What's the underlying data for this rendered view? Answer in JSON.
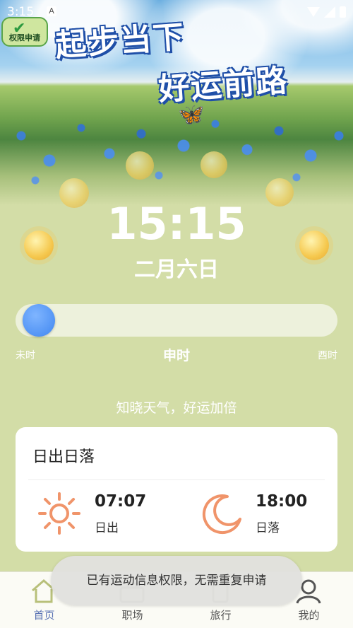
{
  "status_bar": {
    "time": "3:15",
    "notification_letter": "A"
  },
  "hero": {
    "badge_label": "权限申请",
    "title_line1": "起步当下",
    "title_line2": "好运前路"
  },
  "clock": {
    "time": "15:15",
    "date": "二月六日"
  },
  "hour_slider": {
    "prev_label": "未时",
    "current_label": "申时",
    "next_label": "酉时",
    "value": 0.0
  },
  "slogan": "知晓天气，好运加倍",
  "sun_card": {
    "title": "日出日落",
    "sunrise_time": "07:07",
    "sunrise_label": "日出",
    "sunset_time": "18:00",
    "sunset_label": "日落",
    "icon_color": "#f0946a"
  },
  "toast": "已有运动信息权限，无需重复申请",
  "tabs": [
    {
      "label": "首页",
      "icon": "home-icon",
      "active": true
    },
    {
      "label": "职场",
      "icon": "briefcase-icon",
      "active": false
    },
    {
      "label": "旅行",
      "icon": "travel-icon",
      "active": false
    },
    {
      "label": "我的",
      "icon": "user-icon",
      "active": false
    }
  ],
  "colors": {
    "background": "#d3dda7",
    "accent": "#5a73b4",
    "slider_knob": "#3f86f0"
  }
}
